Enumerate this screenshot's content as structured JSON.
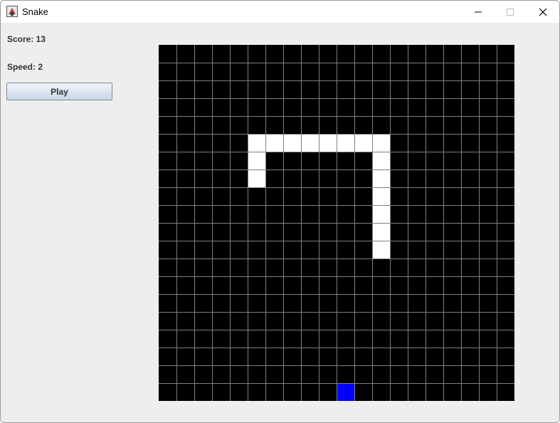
{
  "window": {
    "title": "Snake",
    "icon": "java-app-icon",
    "controls": [
      "minimize-icon",
      "maximize-icon",
      "close-icon"
    ]
  },
  "sidebar": {
    "score_text": "Score: 13",
    "speed_text": "Speed: 2",
    "play_label": "Play"
  },
  "board": {
    "columns": 20,
    "rows": 20,
    "background_color": "#000000",
    "grid_color": "#808080",
    "snake_color": "#ffffff",
    "food_color": "#0000ff",
    "snake_cells": [
      [
        5,
        5
      ],
      [
        6,
        5
      ],
      [
        7,
        5
      ],
      [
        8,
        5
      ],
      [
        9,
        5
      ],
      [
        10,
        5
      ],
      [
        11,
        5
      ],
      [
        12,
        5
      ],
      [
        5,
        6
      ],
      [
        5,
        7
      ],
      [
        12,
        6
      ],
      [
        12,
        7
      ],
      [
        12,
        8
      ],
      [
        12,
        9
      ],
      [
        12,
        10
      ],
      [
        12,
        11
      ]
    ],
    "food_cell": [
      10,
      19
    ]
  }
}
